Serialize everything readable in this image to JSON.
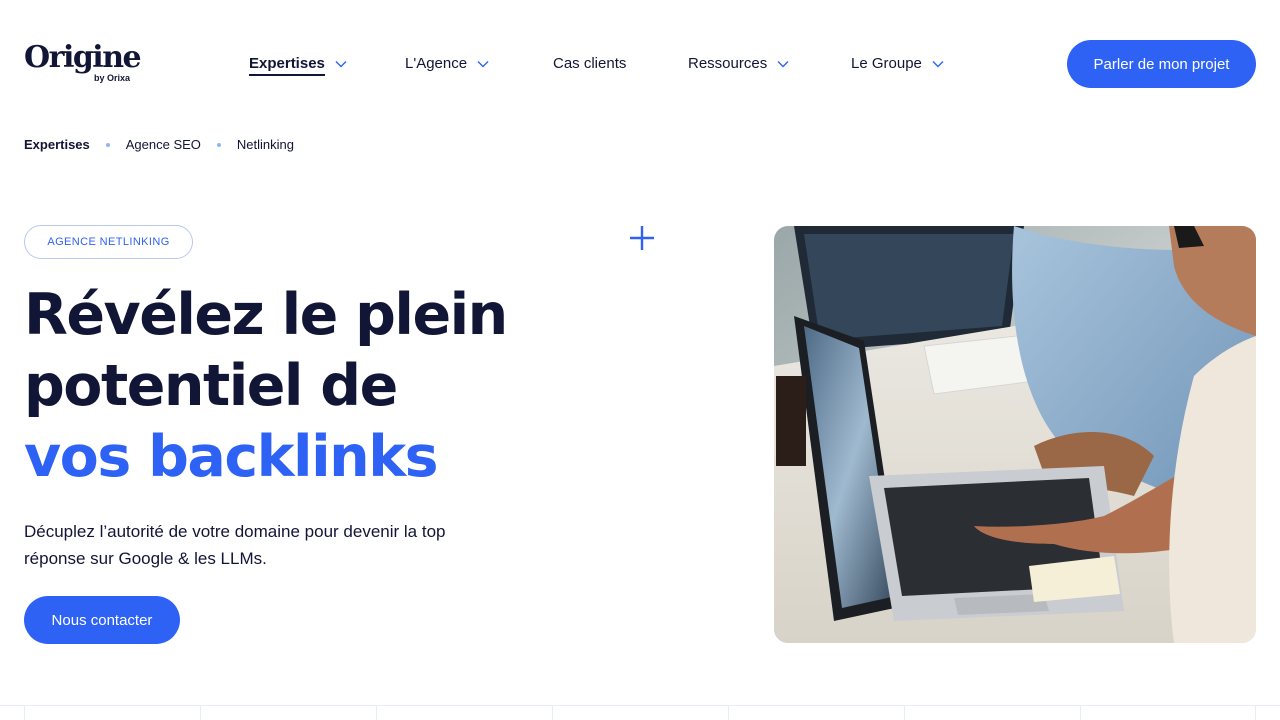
{
  "brand": {
    "name": "Origine",
    "sub": "by Orixa"
  },
  "nav": {
    "items": [
      {
        "label": "Expertises",
        "has_dropdown": true,
        "active": true
      },
      {
        "label": "L'Agence",
        "has_dropdown": true,
        "active": false
      },
      {
        "label": "Cas clients",
        "has_dropdown": false,
        "active": false
      },
      {
        "label": "Ressources",
        "has_dropdown": true,
        "active": false
      },
      {
        "label": "Le Groupe",
        "has_dropdown": true,
        "active": false
      }
    ],
    "cta_label": "Parler de mon projet"
  },
  "breadcrumb": [
    "Expertises",
    "Agence SEO",
    "Netlinking"
  ],
  "hero": {
    "tag": "AGENCE NETLINKING",
    "headline_line1": "Révélez le plein",
    "headline_line2": "potentiel de",
    "headline_accent": "vos backlinks",
    "subtitle_line1": "Décuplez l’autorité de votre domaine pour devenir la top",
    "subtitle_line2": "réponse sur Google & les LLMs.",
    "cta_label": "Nous contacter"
  },
  "colors": {
    "accent": "#2e62f5",
    "text_dark": "#111536",
    "breadcrumb_dot": "#8fb7f0"
  },
  "icons": {
    "dropdown": "chevron-down-icon",
    "decor": "plus-icon"
  }
}
